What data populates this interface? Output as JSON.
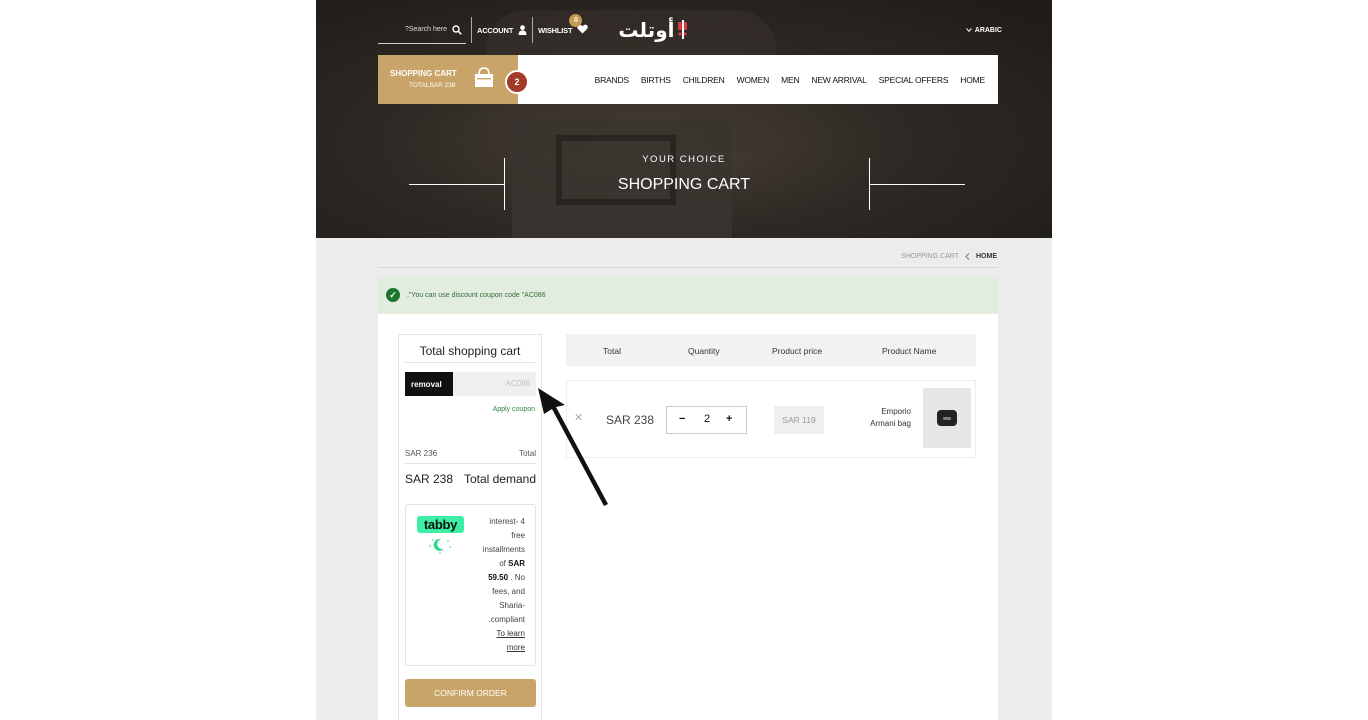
{
  "header": {
    "search_placeholder": "?Search here",
    "account_label": "ACCOUNT",
    "wishlist_label": "WISHLIST",
    "wishlist_count": "0",
    "logo_text": "أوتلت",
    "language_label": "ARABIC"
  },
  "nav": {
    "cart_label": "SHOPPING CART",
    "cart_total": "TOTALSAR 238",
    "cart_count": "2",
    "items": [
      "BRANDS",
      "BIRTHS",
      "CHILDREN",
      "WOMEN",
      "MEN",
      "NEW ARRIVAL",
      "SPECIAL OFFERS",
      "HOME"
    ]
  },
  "hero": {
    "subtitle": "YOUR CHOICE",
    "title": "SHOPPING CART"
  },
  "breadcrumb": {
    "current": "SHOPPING CART",
    "home": "HOME"
  },
  "notice": {
    "text": ".\"You can use discount coupon code \"AC086"
  },
  "summary": {
    "title": "Total shopping cart",
    "removal_label": "removal",
    "coupon_code": "AC086",
    "apply_label": "Apply coupon",
    "total_value": "SAR 236",
    "total_label": "Total",
    "demand_value": "SAR 238",
    "demand_label": "Total demand",
    "confirm_label": "CONFIRM ORDER"
  },
  "tabby": {
    "logo": "tabby",
    "line1": "interest- 4",
    "line2": "free",
    "line3": "installments",
    "line4": "of",
    "amount": "SAR",
    "amount2": "59.50",
    "line5": ". No",
    "line6": "fees, and",
    "line7": "Sharia-",
    "line8": ".compliant",
    "learn1": "To learn",
    "learn2": "more"
  },
  "table": {
    "headers": {
      "total": "Total",
      "quantity": "Quantity",
      "price": "Product price",
      "name": "Product Name"
    },
    "rows": [
      {
        "total": "SAR 238",
        "quantity": "2",
        "price": "SAR 119",
        "name_line1": "Emporio",
        "name_line2": "Armani bag"
      }
    ]
  },
  "icons": {
    "search": "search-icon",
    "account": "user-icon",
    "wishlist": "heart-icon",
    "cart": "shopping-bag-icon",
    "chevron": "chevron-down-icon",
    "check": "check-circle-icon",
    "remove": "close-icon"
  },
  "colors": {
    "accent": "#c9a468",
    "badge": "#a33a2a",
    "success": "#1d7530",
    "tabby": "#3bf0a5"
  }
}
